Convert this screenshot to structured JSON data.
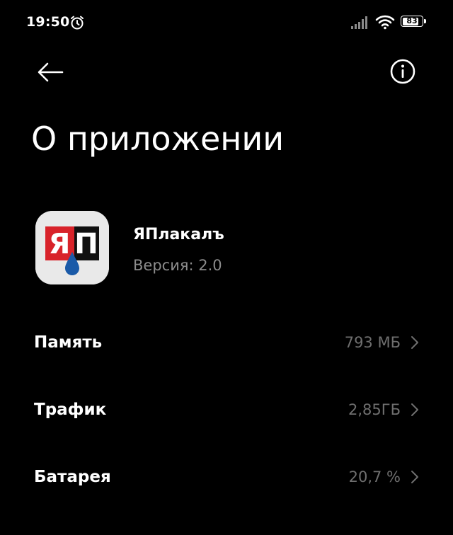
{
  "status_bar": {
    "time": "19:50",
    "battery_level": "83",
    "icons": [
      "alarm-clock-icon",
      "cellular-signal-icon",
      "wifi-icon",
      "battery-icon"
    ]
  },
  "header": {
    "back_icon": "arrow-left-icon",
    "info_icon": "info-circle-icon",
    "title": "О приложении"
  },
  "app": {
    "icon_text": "ЯП",
    "name": "ЯПлакалъ",
    "version": "Версия: 2.0"
  },
  "rows": [
    {
      "label": "Память",
      "value": "793 МБ"
    },
    {
      "label": "Трафик",
      "value": "2,85ГБ"
    },
    {
      "label": "Батарея",
      "value": "20,7 %"
    }
  ],
  "colors": {
    "background": "#000000",
    "primary_text": "#ffffff",
    "secondary_text": "#8c8c8c",
    "value_text": "#6f6f6f",
    "app_icon_red": "#d8232a",
    "app_icon_blue": "#1a5aa8",
    "app_icon_bg": "#e9e9e9"
  }
}
